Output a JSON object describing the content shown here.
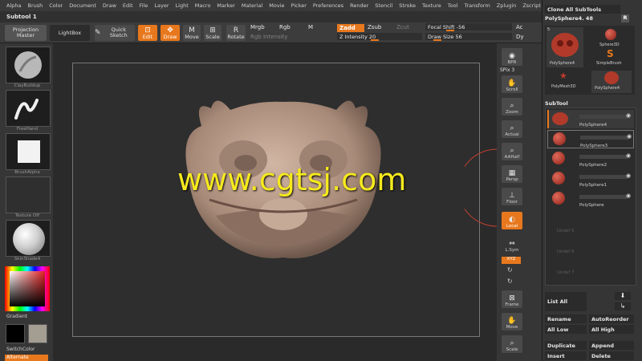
{
  "menu": [
    "Alpha",
    "Brush",
    "Color",
    "Document",
    "Draw",
    "Edit",
    "File",
    "Layer",
    "Light",
    "Macro",
    "Marker",
    "Material",
    "Movie",
    "Picker",
    "Preferences",
    "Render",
    "Stencil",
    "Stroke",
    "Texture",
    "Tool",
    "Transform",
    "Zplugin",
    "Zscript"
  ],
  "title": "Subtool 1",
  "toolbar": {
    "projection_master": "Projection Master",
    "lightbox": "LightBox",
    "quick_sketch": "Quick Sketch",
    "edit": "Edit",
    "draw": "Draw",
    "move": "Move",
    "scale": "Scale",
    "rotate": "Rotate",
    "mrgb": "Mrgb",
    "rgb": "Rgb",
    "m": "M",
    "rgb_intensity": "Rgb Intensity",
    "zadd": "Zadd",
    "zsub": "Zsub",
    "zcut": "Zcut",
    "z_intensity": "Z Intensity 20",
    "focal_shift": "Focal Shift -56",
    "draw_size": "Draw Size 56",
    "ac": "Ac",
    "dy": "Dy"
  },
  "left_panel": {
    "clay_buildup": "ClayBuildup",
    "freehand": "FreeHand",
    "brush_alpha": "BrushAlpha",
    "texture_off": "Texture Off",
    "skin_shade": "SkinShade4",
    "gradient": "Gradient",
    "switch_color": "SwitchColor",
    "alternate": "Alternate"
  },
  "watermark": "www.cgtsj.com",
  "right_tools": [
    "BPR",
    "SPix 3",
    "Scroll",
    "Zoom",
    "Actual",
    "AAHalf",
    "Persp",
    "Floor",
    "Local",
    "L.Sym",
    "XYZ",
    "Frame",
    "Move",
    "Scale"
  ],
  "right_panel": {
    "clone_all": "Clone All SubTools",
    "r_btn": "R",
    "current_tool": "PolySphere4. 48",
    "tool_thumbs": [
      "PolySphere4",
      "Sphere3D",
      "SimpleBrush",
      "PolyMesh3D",
      "PolySphere4"
    ],
    "thumb_count": "5",
    "subtool_header": "SubTool",
    "subtools": [
      "PolySphere4",
      "PolySphere3",
      "PolySphere2",
      "PolySphere1",
      "PolySphere"
    ],
    "empties": [
      "Undef 5",
      "Undef 6",
      "Undef 7"
    ],
    "list_all": "List All",
    "rename": "Rename",
    "auto_reorder": "AutoReorder",
    "all_low": "All Low",
    "all_high": "All High",
    "duplicate": "Duplicate",
    "append": "Append",
    "insert": "Insert",
    "delete": "Delete"
  },
  "colors": {
    "accent": "#e8781d",
    "watermark": "#f6ea1e",
    "model": "#b59a88"
  }
}
